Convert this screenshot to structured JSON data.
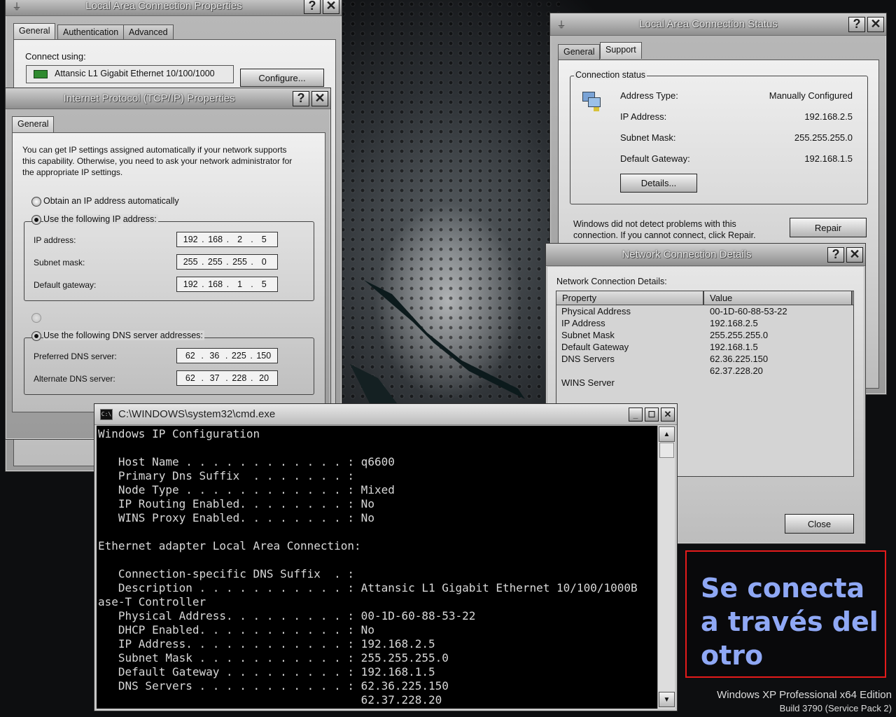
{
  "colors": {
    "note_border": "#e41b1b",
    "note_text": "#8fa8f5",
    "cmd_bg": "#000000",
    "cmd_text": "#d8d8d8"
  },
  "lac_props": {
    "title": "Local Area Connection Properties",
    "tabs": [
      "General",
      "Authentication",
      "Advanced"
    ],
    "connect_using_label": "Connect using:",
    "adapter_name": "Attansic L1 Gigabit Ethernet 10/100/1000",
    "configure_label": "Configure..."
  },
  "tcpip": {
    "title": "Internet Protocol (TCP/IP) Properties",
    "tab": "General",
    "intro": "You can get IP settings assigned automatically if your network supports this capability. Otherwise, you need to ask your network administrator for the appropriate IP settings.",
    "radio_auto_ip": "Obtain an IP address automatically",
    "radio_use_ip": "Use the following IP address:",
    "ip_label": "IP address:",
    "ip": [
      "192",
      "168",
      "2",
      "5"
    ],
    "mask_label": "Subnet mask:",
    "mask": [
      "255",
      "255",
      "255",
      "0"
    ],
    "gateway_label": "Default gateway:",
    "gateway": [
      "192",
      "168",
      "1",
      "5"
    ],
    "radio_use_dns": "Use the following DNS server addresses:",
    "pref_dns_label": "Preferred DNS server:",
    "pref_dns": [
      "62",
      "36",
      "225",
      "150"
    ],
    "alt_dns_label": "Alternate DNS server:",
    "alt_dns": [
      "62",
      "37",
      "228",
      "20"
    ]
  },
  "status": {
    "title": "Local Area Connection Status",
    "tabs": [
      "General",
      "Support"
    ],
    "group_label": "Connection status",
    "rows": [
      {
        "label": "Address Type:",
        "value": "Manually Configured"
      },
      {
        "label": "IP Address:",
        "value": "192.168.2.5"
      },
      {
        "label": "Subnet Mask:",
        "value": "255.255.255.0"
      },
      {
        "label": "Default Gateway:",
        "value": "192.168.1.5"
      }
    ],
    "details_label": "Details...",
    "repair_text": "Windows did not detect problems with this connection. If you cannot connect, click Repair.",
    "repair_label": "Repair"
  },
  "details": {
    "title": "Network Connection Details",
    "heading": "Network Connection Details:",
    "col_property": "Property",
    "col_value": "Value",
    "rows": [
      {
        "p": "Physical Address",
        "v": "00-1D-60-88-53-22"
      },
      {
        "p": "IP Address",
        "v": "192.168.2.5"
      },
      {
        "p": "Subnet Mask",
        "v": "255.255.255.0"
      },
      {
        "p": "Default Gateway",
        "v": "192.168.1.5"
      },
      {
        "p": "DNS Servers",
        "v": "62.36.225.150"
      },
      {
        "p": "",
        "v": "62.37.228.20"
      },
      {
        "p": "WINS Server",
        "v": ""
      }
    ],
    "close_label": "Close"
  },
  "cmd": {
    "title": "C:\\WINDOWS\\system32\\cmd.exe",
    "lines": [
      "Windows IP Configuration",
      "",
      "   Host Name . . . . . . . . . . . . : q6600",
      "   Primary Dns Suffix  . . . . . . . :",
      "   Node Type . . . . . . . . . . . . : Mixed",
      "   IP Routing Enabled. . . . . . . . : No",
      "   WINS Proxy Enabled. . . . . . . . : No",
      "",
      "Ethernet adapter Local Area Connection:",
      "",
      "   Connection-specific DNS Suffix  . :",
      "   Description . . . . . . . . . . . : Attansic L1 Gigabit Ethernet 10/100/1000B",
      "ase-T Controller",
      "   Physical Address. . . . . . . . . : 00-1D-60-88-53-22",
      "   DHCP Enabled. . . . . . . . . . . : No",
      "   IP Address. . . . . . . . . . . . : 192.168.2.5",
      "   Subnet Mask . . . . . . . . . . . : 255.255.255.0",
      "   Default Gateway . . . . . . . . . : 192.168.1.5",
      "   DNS Servers . . . . . . . . . . . : 62.36.225.150",
      "                                       62.37.228.20"
    ]
  },
  "note": {
    "text": "Se conecta\na través del\notro"
  },
  "brand": {
    "line1": "Windows XP Professional x64 Edition",
    "line2": "Build 3790 (Service Pack 2)"
  }
}
